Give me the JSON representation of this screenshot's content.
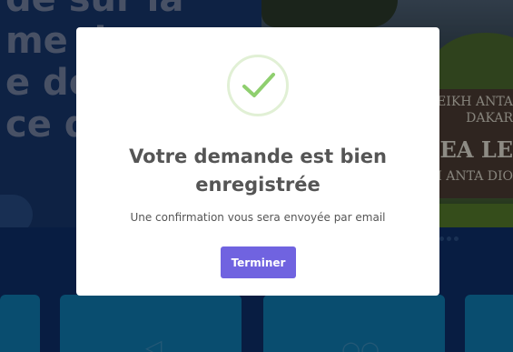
{
  "background": {
    "hero_lines": [
      "de sur la",
      "me d",
      "e de",
      "ce d"
    ],
    "sign_lines": [
      "HEIKH ANTA",
      "DAKAR",
      "IEA LE",
      "CHEIKH ANTA DIO"
    ]
  },
  "modal": {
    "title": "Votre demande est bien enregistrée",
    "message": "Une confirmation vous sera envoyée par email",
    "finish_label": "Terminer",
    "icon": "check-circle-icon"
  },
  "colors": {
    "accent_button": "#7063e0",
    "success_check": "#8fcf6f",
    "page_navy": "#0d2f6b",
    "card_blue": "#0f7db3"
  }
}
